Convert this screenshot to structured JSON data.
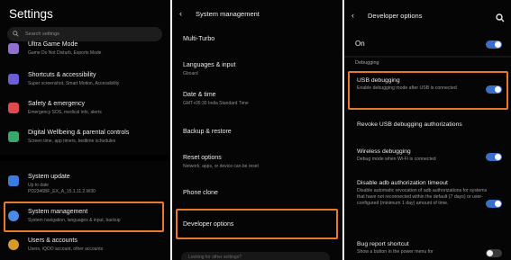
{
  "panel1": {
    "title": "Settings",
    "search_placeholder": "Search settings",
    "items": [
      {
        "title": "Ultra Game Mode",
        "subtitle": "Game Do Not Disturb, Esports Mode",
        "icon": "game-icon",
        "color": "#8f6fd1"
      },
      {
        "title": "Shortcuts & accessibility",
        "subtitle": "Super screenshot, Smart Motion, Accessibility",
        "icon": "shortcuts-icon",
        "color": "#6b5fd8"
      },
      {
        "title": "Safety & emergency",
        "subtitle": "Emergency SOS, medical info, alerts",
        "icon": "safety-icon",
        "color": "#e04a4a"
      },
      {
        "title": "Digital Wellbeing & parental controls",
        "subtitle": "Screen time, app timers, bedtime schedules",
        "icon": "wellbeing-icon",
        "color": "#3aa86b"
      },
      {
        "title": "System update",
        "subtitle": "Up to date",
        "subtitle2": "PD2346BF_EX_A_15.1.11.2.W30",
        "icon": "system-update-icon",
        "color": "#3b7be0"
      },
      {
        "title": "System management",
        "subtitle": "System navigation, languages & input, backup",
        "icon": "gear-icon",
        "color": "#4a8ae8"
      },
      {
        "title": "Users & accounts",
        "subtitle": "Users, iQOO account, other accounts",
        "icon": "user-icon",
        "color": "#d89a2a"
      }
    ]
  },
  "panel2": {
    "title": "System management",
    "items": [
      {
        "title": "Multi-Turbo",
        "subtitle": ""
      },
      {
        "title": "Languages & input",
        "subtitle": "Gboard"
      },
      {
        "title": "Date & time",
        "subtitle": "GMT+05:30 India Standard Time"
      },
      {
        "title": "Backup & restore",
        "subtitle": ""
      },
      {
        "title": "Reset options",
        "subtitle": "Network, apps, or device can be reset"
      },
      {
        "title": "Phone clone",
        "subtitle": ""
      },
      {
        "title": "Developer options",
        "subtitle": ""
      }
    ],
    "footer": "Looking for other settings?"
  },
  "panel3": {
    "title": "Developer options",
    "on_label": "On",
    "category": "Debugging",
    "items": [
      {
        "title": "USB debugging",
        "subtitle": "Enable debugging mode after USB is connected",
        "toggle": true
      },
      {
        "title": "Revoke USB debugging authorizations",
        "subtitle": "",
        "toggle": null
      },
      {
        "title": "Wireless debugging",
        "subtitle": "Debug mode when Wi-Fi is connected",
        "toggle": true
      },
      {
        "title": "Disable adb authorization timeout",
        "subtitle": "Disable automatic revocation of adb authorizations for systems that have not reconnected within the default (7 days) or user-configured (minimum 1 day) amount of time.",
        "toggle": true
      },
      {
        "title": "Bug report shortcut",
        "subtitle": "Show a button in the power menu for",
        "toggle": false
      }
    ]
  },
  "colors": {
    "highlight": "#e8782a",
    "accent": "#3a6fc9",
    "background": "#050505"
  }
}
